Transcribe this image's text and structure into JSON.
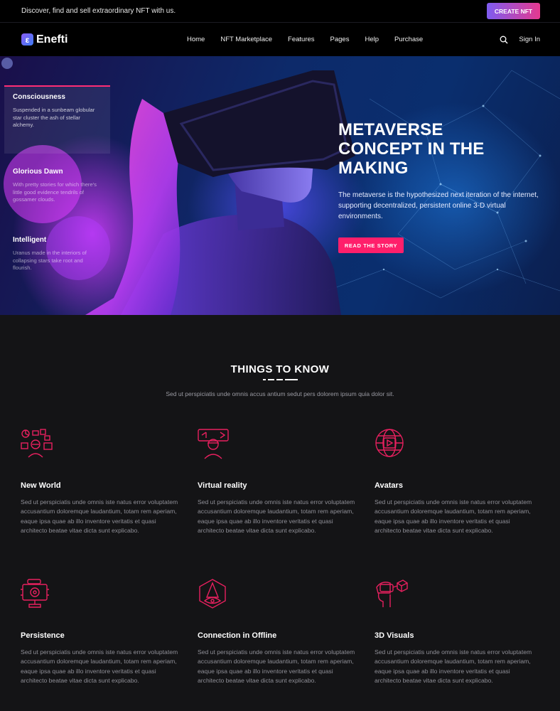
{
  "topbar": {
    "tagline": "Discover, find and sell extraordinary NFT with us.",
    "create_label": "CREATE NFT"
  },
  "brand": {
    "badge": "ε",
    "name": "Enefti"
  },
  "nav": {
    "items": [
      "Home",
      "NFT Marketplace",
      "Features",
      "Pages",
      "Help",
      "Purchase"
    ],
    "signin": "Sign In"
  },
  "hero": {
    "cards": [
      {
        "title": "Consciousness",
        "desc": "Suspended in a sunbeam globular star cluster the ash of stellar alchemy."
      },
      {
        "title": "Glorious Dawn",
        "desc": "With pretty stories for which there's little good evidence tendrils of gossamer clouds."
      },
      {
        "title": "Intelligent",
        "desc": "Uranus made in the interiors of collapsing stars take root and flourish."
      }
    ],
    "title_lines": [
      "METAVERSE",
      "CONCEPT IN THE",
      "MAKING"
    ],
    "subtitle": "The metaverse is the hypothesized next iteration of the internet, supporting decentralized, persistent online 3-D virtual environments.",
    "button": "READ THE STORY"
  },
  "things": {
    "title": "THINGS TO KNOW",
    "subtitle": "Sed ut perspiciatis unde omnis accus antium sedut pers dolorem ipsum quia dolor sit.",
    "features": [
      {
        "title": "New World",
        "icon": "new-world-icon",
        "desc": "Sed ut perspiciatis unde omnis iste natus error voluptatem accusantium doloremque laudantium, totam rem aperiam, eaque ipsa quae ab illo inventore veritatis et quasi architecto beatae vitae dicta sunt explicabo."
      },
      {
        "title": "Virtual reality",
        "icon": "vr-headset-icon",
        "desc": "Sed ut perspiciatis unde omnis iste natus error voluptatem accusantium doloremque laudantium, totam rem aperiam, eaque ipsa quae ab illo inventore veritatis et quasi architecto beatae vitae dicta sunt explicabo."
      },
      {
        "title": "Avatars",
        "icon": "globe-play-icon",
        "desc": "Sed ut perspiciatis unde omnis iste natus error voluptatem accusantium doloremque laudantium, totam rem aperiam, eaque ipsa quae ab illo inventore veritatis et quasi architecto beatae vitae dicta sunt explicabo."
      },
      {
        "title": "Persistence",
        "icon": "monitor-robot-icon",
        "desc": "Sed ut perspiciatis unde omnis iste natus error voluptatem accusantium doloremque laudantium, totam rem aperiam, eaque ipsa quae ab illo inventore veritatis et quasi architecto beatae vitae dicta sunt explicabo."
      },
      {
        "title": "Connection in Offline",
        "icon": "cube-eye-icon",
        "desc": "Sed ut perspiciatis unde omnis iste natus error voluptatem accusantium doloremque laudantium, totam rem aperiam, eaque ipsa quae ab illo inventore veritatis et quasi architecto beatae vitae dicta sunt explicabo."
      },
      {
        "title": "3D Visuals",
        "icon": "vr-cube-icon",
        "desc": "Sed ut perspiciatis unde omnis iste natus error voluptatem accusantium doloremque laudantium, totam rem aperiam, eaque ipsa quae ab illo inventore veritatis et quasi architecto beatae vitae dicta sunt explicabo."
      }
    ]
  },
  "colors": {
    "accent": "#ff1f6b",
    "icon": "#e8205f",
    "gradient_start": "#7e5cf0",
    "gradient_end": "#e5398f",
    "background": "#141416"
  }
}
